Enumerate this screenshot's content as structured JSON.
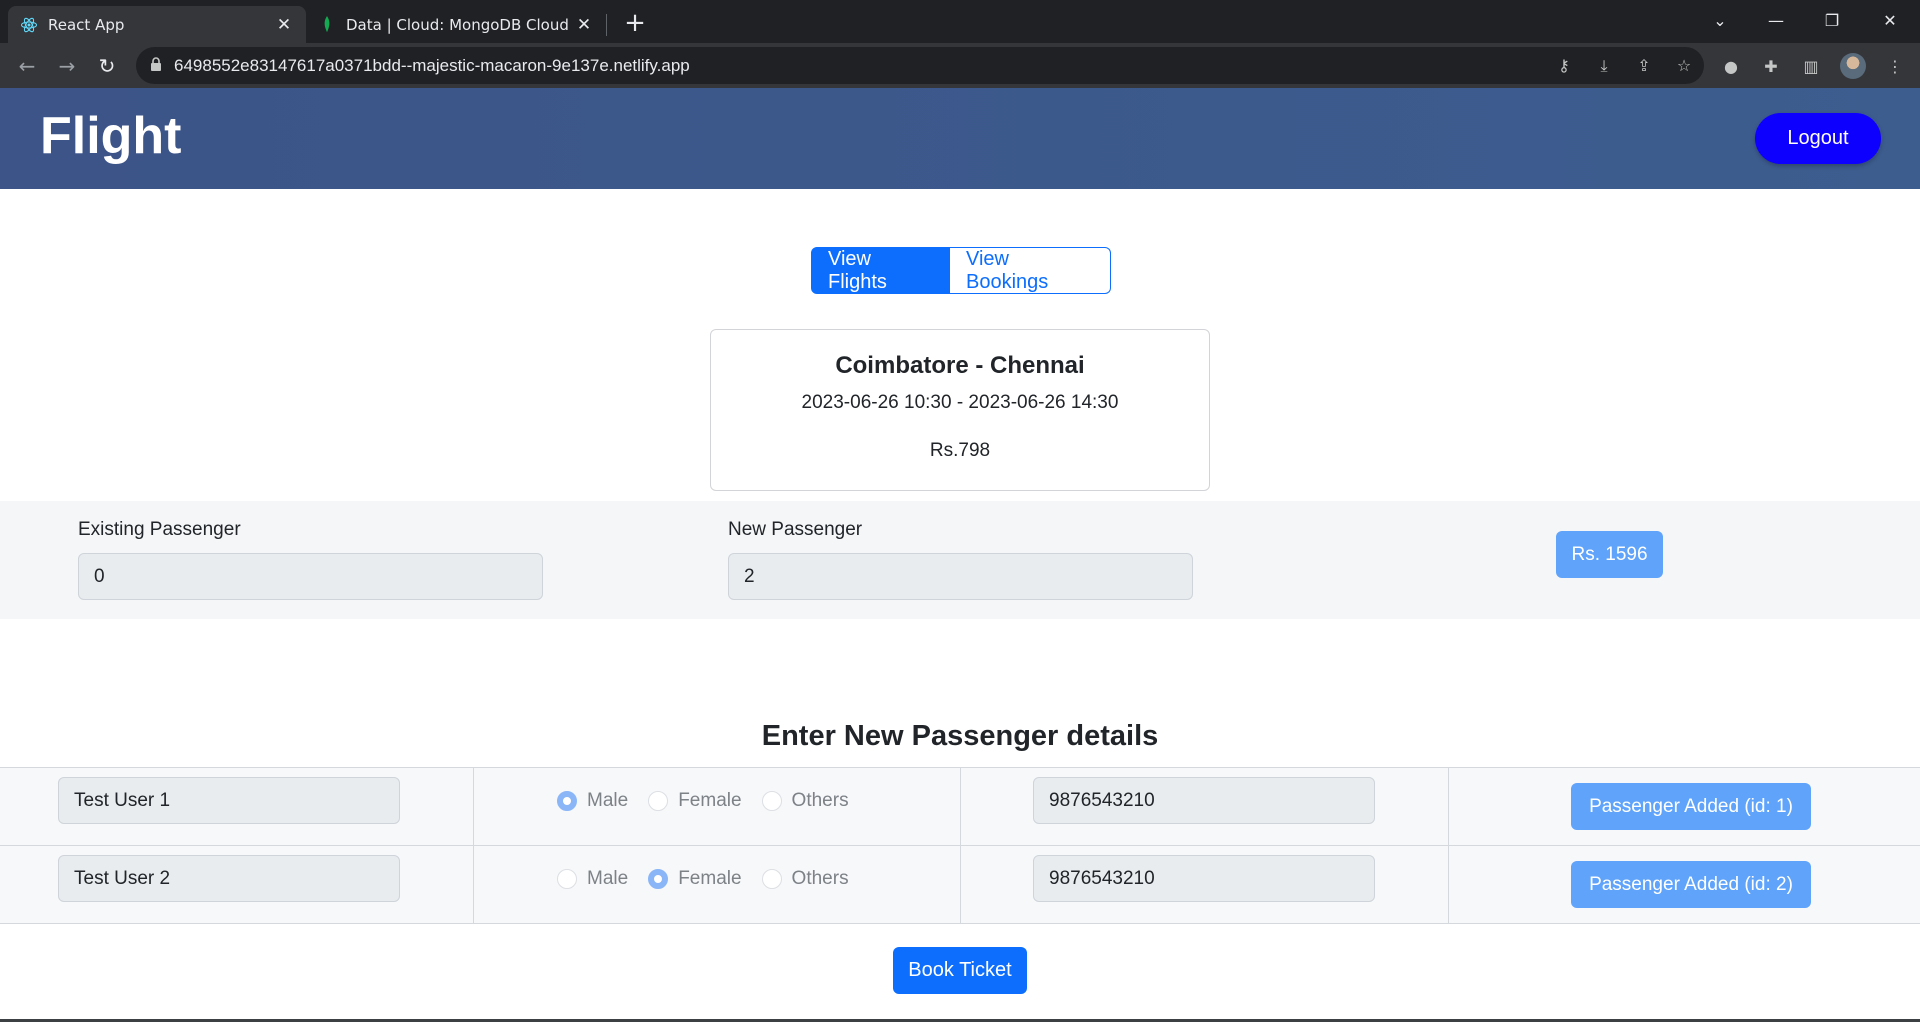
{
  "browser": {
    "tabs": [
      {
        "title": "React App",
        "active": true,
        "favicon": "react-icon"
      },
      {
        "title": "Data | Cloud: MongoDB Cloud",
        "active": false,
        "favicon": "mongodb-leaf-icon"
      }
    ],
    "url": "6498552e83147617a0371bdd--majestic-macaron-9e137e.netlify.app"
  },
  "header": {
    "brand": "Flight",
    "logout_label": "Logout"
  },
  "view_tabs": {
    "flights_label": "View Flights",
    "bookings_label": "View Bookings",
    "selected": "View Flights"
  },
  "flight": {
    "route": "Coimbatore - Chennai",
    "times": "2023-06-26 10:30 - 2023-06-26 14:30",
    "price": "Rs.798"
  },
  "passenger_counts": {
    "existing_label": "Existing Passenger",
    "existing_value": "0",
    "new_label": "New Passenger",
    "new_value": "2",
    "total_label": "Rs. 1596"
  },
  "new_passengers": {
    "title": "Enter New Passenger details",
    "gender_options": [
      "Male",
      "Female",
      "Others"
    ],
    "rows": [
      {
        "name": "Test User 1",
        "gender": "Male",
        "phone": "9876543210",
        "status": "Passenger Added (id: 1)"
      },
      {
        "name": "Test User 2",
        "gender": "Female",
        "phone": "9876543210",
        "status": "Passenger Added (id: 2)"
      }
    ]
  },
  "book_label": "Book Ticket",
  "colors": {
    "header_bg": "#3c5488",
    "logout_bg": "#0d00ff",
    "primary": "#0d6efd",
    "primary_disabled": "#5fa3fb"
  }
}
